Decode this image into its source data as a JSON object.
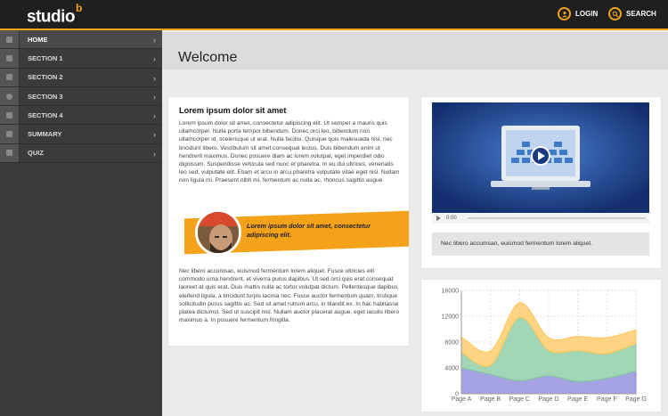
{
  "header": {
    "logo_text": "studio",
    "logo_sup": "b",
    "login_label": "LOGIN",
    "search_label": "SEARCH"
  },
  "sidebar": {
    "items": [
      {
        "label": "HOME",
        "icon": "home-icon"
      },
      {
        "label": "SECTION 1",
        "icon": "book-icon"
      },
      {
        "label": "SECTION 2",
        "icon": "people-icon"
      },
      {
        "label": "SECTION 3",
        "icon": "gear-icon"
      },
      {
        "label": "SECTION 4",
        "icon": "tag-icon"
      },
      {
        "label": "SUMMARY",
        "icon": "thumb-icon"
      },
      {
        "label": "QUIZ",
        "icon": "document-icon"
      }
    ]
  },
  "main": {
    "title": "Welcome",
    "article": {
      "heading": "Lorem ipsum dolor sit amet",
      "paragraph1": "Lorem ipsum dolor sit amet, consectetur adipiscing elit. Ut semper a mauris quis ullamcorper. Nulla porta tempor bibendum. Donec orci leo, bibendum non ullamcorper id, scelerisque ut erat. Nulla facilisi. Quisque quis malesuada nisi, nec tincidunt libero. Vestibulum sit amet consequat lectus. Duis bibendum enim ut hendrerit maximus. Donec posuere diam ac lorem volutpat, eget imperdiet odio dignissim. Suspendisse vehicula sed nunc et pharetra. In eu dui ultrices, venenatis leo sed, vulputate elit. Etiam et arcu in arcu pharetra vulputate vitae eget nisi. Nullam non ligula mi. Praesent nibh mi, fermentum ac nulla ac, rhoncus sagittis augue.",
      "quote": "Lorem ipsum dolor sit amet, consectetur adipiscing elit.",
      "paragraph2": "Nec libero accumsan, euismod fermentum lorem aliquet. Fusce ultricies elit commodo urna hendrerit, et viverra purus dapibus. Ut sed orci quis erat consequat laoreet at quis erat. Duis mattis nulla ac tortor volutpat dictum. Pellentesque dapibus eleifend ligula, a tincidunt turpis lacinia nec. Fusce auctor fermentum quam, tristique sollicitudin purus sagittis ac. Sed sit amet rutrum arcu, in blandit ex. In hac habitasse platea dictumst. Sed ut suscipit nisl. Nullam auctor placerat augue, eget iaculis libero maximus a. In posuere fermentum fringilla."
    },
    "video": {
      "time": "0:00",
      "caption": "Nec libero accumsan, euismod fermentum lorem aliquet."
    }
  },
  "colors": {
    "accent": "#f5a21b",
    "topbar": "#1f1f1f",
    "sidebar": "#3b3b3b"
  },
  "chart_data": {
    "type": "area",
    "categories": [
      "Page A",
      "Page B",
      "Page C",
      "Page D",
      "Page E",
      "Page F",
      "Page G"
    ],
    "ylim": [
      0,
      16000
    ],
    "yticks": [
      0,
      4000,
      8000,
      12000,
      16000
    ],
    "series": [
      {
        "values": [
          4000,
          3000,
          2000,
          2780,
          1890,
          2390,
          3490
        ],
        "color": "#8884d8"
      },
      {
        "values": [
          2400,
          1398,
          9800,
          3908,
          4800,
          3800,
          4300
        ],
        "color": "#82ca9d"
      },
      {
        "values": [
          2400,
          2210,
          2290,
          2000,
          2181,
          2500,
          2100
        ],
        "color": "#ffc658"
      }
    ]
  }
}
